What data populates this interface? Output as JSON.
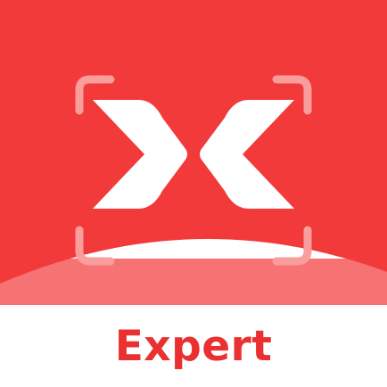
{
  "app_icon": {
    "logo_letter": "X",
    "label": "Expert",
    "colors": {
      "primary_red": "#f23a3a",
      "light_red_band": "#f77272",
      "corner_brackets": "#f99d9d",
      "logo_fill": "#ffffff",
      "label_text": "#ea3030",
      "background": "#ffffff"
    },
    "icons": [
      "x-logo-icon",
      "scan-frame-icon"
    ]
  }
}
